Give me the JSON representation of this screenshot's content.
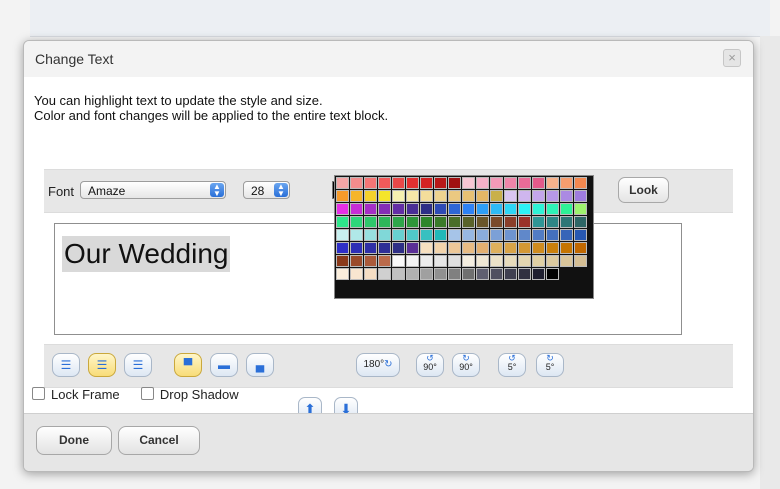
{
  "dialog": {
    "title": "Change Text",
    "close_icon": "close-icon",
    "intro_line1": "You can highlight text to update the style and size.",
    "intro_line2": "Color and font changes will be applied to the entire text block."
  },
  "font_bar": {
    "font_label": "Font",
    "font_value": "Amaze",
    "size_value": "28",
    "current_color": "#000000",
    "look_label": "Look"
  },
  "text_block": {
    "content": "Our Wedding"
  },
  "palette": {
    "rows": [
      [
        "#f4a6a6",
        "#f28c8c",
        "#f47575",
        "#f25a5a",
        "#e84848",
        "#e23030",
        "#d42222",
        "#b81818",
        "#a01010",
        "#f7c6d3",
        "#f5b1c7",
        "#f29ab8",
        "#ef85a9",
        "#ea6b98",
        "#e35a8a",
        "#f7b28c",
        "#f59d6f",
        "#f28850"
      ],
      [
        "#f59a2a",
        "#f5b52a",
        "#f5d12a",
        "#f5e52a",
        "#f7f0b0",
        "#f6e7a8",
        "#f3dd9b",
        "#efd38f",
        "#ebc981",
        "#e8c074",
        "#e4b766",
        "#c9b04a",
        "#d9c6f2",
        "#cfb6ee",
        "#c3a6ea",
        "#b798e6",
        "#ab8ae2",
        "#9f7cde"
      ],
      [
        "#e62ee6",
        "#c62ed6",
        "#a52ec6",
        "#842eb6",
        "#632ea6",
        "#4a2e96",
        "#2e2e86",
        "#2e4ab6",
        "#2e66d6",
        "#2e82f6",
        "#2e9ef6",
        "#2ebaf6",
        "#2ed6f6",
        "#2ef2f6",
        "#2ef2d6",
        "#2ef2b6",
        "#2ef296",
        "#9ef26e"
      ],
      [
        "#2ee68a",
        "#2ed67a",
        "#2ec66a",
        "#2eb65a",
        "#2ea64a",
        "#2e963a",
        "#2e862a",
        "#3a7a2a",
        "#4a6e2a",
        "#5a622a",
        "#6a562a",
        "#7a4a2a",
        "#8a3e2a",
        "#9a322a",
        "#2e9696",
        "#2e8686",
        "#2e7676",
        "#2e6666"
      ],
      [
        "#c8f0f0",
        "#b0e8e8",
        "#98e0e0",
        "#80d8d8",
        "#68d0d0",
        "#50c8c8",
        "#38c0c0",
        "#20b8b8",
        "#a6c4e8",
        "#98b8e2",
        "#8aacdc",
        "#7ca0d6",
        "#6e94d0",
        "#6088ca",
        "#527cc4",
        "#4470be",
        "#3664b8",
        "#2858b2"
      ],
      [
        "#2e2ec6",
        "#2e2eb6",
        "#2e2ea6",
        "#2e2e96",
        "#2e2e86",
        "#5a2e96",
        "#f7e0c0",
        "#f2d4ac",
        "#edc898",
        "#e8bc84",
        "#e3b070",
        "#deb05c",
        "#d9a448",
        "#d49834",
        "#cf8c20",
        "#ca800c",
        "#c57400",
        "#c06800"
      ],
      [
        "#8a3a1a",
        "#9a4a2a",
        "#aa5a3a",
        "#ba6a4a",
        "#f8f8f8",
        "#f2f2f2",
        "#ececec",
        "#e6e6e6",
        "#e0e0e0",
        "#f4eee0",
        "#f0e8d4",
        "#ece2c8",
        "#e8dcbc",
        "#e4d6b0",
        "#e0d0a4",
        "#dccaa0",
        "#d8c49a",
        "#d4be94"
      ],
      [
        "#fbeedc",
        "#f8e6d0",
        "#f5dec4",
        "#d0d0d0",
        "#c0c0c0",
        "#b0b0b0",
        "#a0a0a0",
        "#909090",
        "#808080",
        "#707070",
        "#606070",
        "#505060",
        "#404050",
        "#303040",
        "#202030",
        "#000000"
      ]
    ]
  },
  "align_toolbar": {
    "align_left_icon": "align-left-icon",
    "align_center_icon": "align-center-icon",
    "align_right_icon": "align-right-icon",
    "valign_top_icon": "valign-top-icon",
    "valign_middle_icon": "valign-middle-icon",
    "valign_bottom_icon": "valign-bottom-icon",
    "rotate_180_label": "180°",
    "rotate_left_90_label": "90°",
    "rotate_right_90_label": "90°",
    "rotate_left_5_label": "5°",
    "rotate_right_5_label": "5°"
  },
  "options": {
    "lock_frame_label": "Lock Frame",
    "drop_shadow_label": "Drop Shadow",
    "move_up_icon": "arrow-up-icon",
    "move_down_icon": "arrow-down-icon"
  },
  "footer": {
    "done_label": "Done",
    "cancel_label": "Cancel"
  }
}
